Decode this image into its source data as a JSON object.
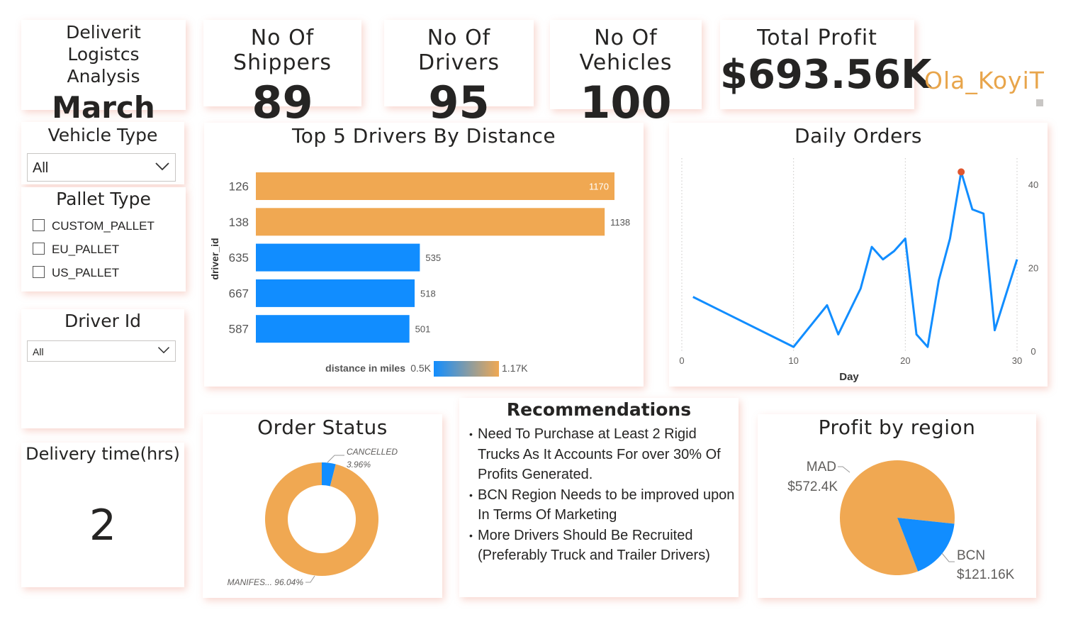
{
  "header": {
    "title": "Deliverit Logistcs Analysis",
    "month": "March"
  },
  "kpis": {
    "shippers": {
      "label": "No Of Shippers",
      "value": "89"
    },
    "drivers": {
      "label": "No Of Drivers",
      "value": "95"
    },
    "vehicles": {
      "label": "No Of Vehicles",
      "value": "100"
    },
    "profit": {
      "label": "Total Profit",
      "value": "$693.56K"
    }
  },
  "author": "Ola_KoyiT",
  "slicers": {
    "vehicle_type": {
      "title": "Vehicle Type",
      "value": "All"
    },
    "pallet_type": {
      "title": "Pallet Type",
      "options": [
        "CUSTOM_PALLET",
        "EU_PALLET",
        "US_PALLET"
      ]
    },
    "driver_id": {
      "title": "Driver Id",
      "value": "All"
    }
  },
  "delivery_time": {
    "label": "Delivery time(hrs)",
    "value": "2"
  },
  "recommendations": {
    "title": "Recommendations",
    "items": [
      "Need To Purchase  at Least 2 Rigid Trucks As It Accounts For over 30% Of Profits Generated.",
      "BCN Region Needs to be improved upon In Terms Of Marketing",
      "More Drivers Should Be Recruited (Preferably Truck and Trailer Drivers)"
    ]
  },
  "colors": {
    "orange": "#F0A852",
    "blue": "#118DFF",
    "accent_text": "#E8A54B"
  },
  "chart_data": [
    {
      "id": "top_drivers",
      "type": "bar",
      "title": "Top 5 Drivers By Distance",
      "ylabel": "driver_id",
      "categories": [
        "126",
        "138",
        "635",
        "667",
        "587"
      ],
      "values": [
        1170,
        1138,
        535,
        518,
        501
      ],
      "data_labels": [
        "1170",
        "1138",
        "535",
        "518",
        "501"
      ],
      "legend": {
        "title": "distance in miles",
        "min_label": "0.5K",
        "max_label": "1.17K"
      },
      "xlim": [
        0,
        1170
      ]
    },
    {
      "id": "daily_orders",
      "type": "line",
      "title": "Daily Orders",
      "xlabel": "Day",
      "x": [
        1,
        10,
        13,
        14,
        16,
        17,
        18,
        19,
        20,
        21,
        22,
        23,
        24,
        25,
        26,
        27,
        28,
        30
      ],
      "y": [
        13,
        1,
        11,
        4,
        15,
        25,
        22,
        24,
        27,
        4,
        1,
        17,
        27,
        43,
        34,
        33,
        5,
        22
      ],
      "xlim": [
        0,
        30
      ],
      "ylim": [
        0,
        48
      ],
      "xticks": [
        "0",
        "10",
        "20",
        "30"
      ],
      "yticks": [
        "0",
        "20",
        "40"
      ],
      "highlight_x": 25
    },
    {
      "id": "order_status",
      "type": "pie",
      "title": "Order Status",
      "donut": true,
      "slices": [
        {
          "label": "CANCELLED",
          "value": 3.96,
          "value_label": "3.96%",
          "color": "#118DFF"
        },
        {
          "label": "MANIFES...",
          "value": 96.04,
          "value_label": "96.04%",
          "color": "#F0A852"
        }
      ]
    },
    {
      "id": "profit_region",
      "type": "pie",
      "title": "Profit by region",
      "slices": [
        {
          "label": "MAD",
          "value": 572.4,
          "value_label": "$572.4K",
          "color": "#F0A852"
        },
        {
          "label": "BCN",
          "value": 121.16,
          "value_label": "$121.16K",
          "color": "#118DFF"
        }
      ]
    }
  ]
}
